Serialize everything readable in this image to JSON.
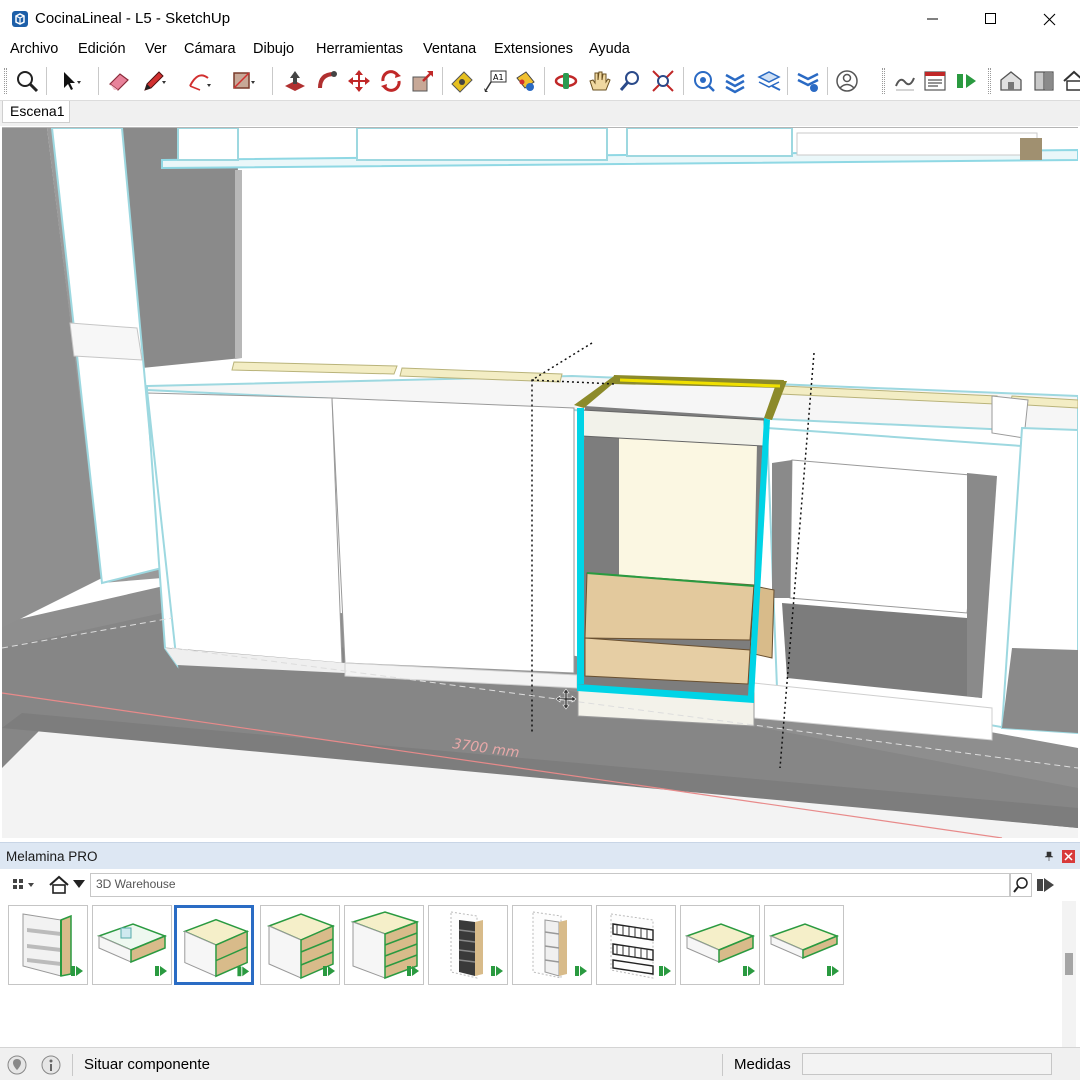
{
  "window": {
    "title": "CocinaLineal - L5 - SketchUp",
    "minimize_icon": "minimize-icon",
    "maximize_icon": "maximize-icon",
    "close_icon": "close-icon"
  },
  "menu": {
    "items": [
      "Archivo",
      "Edición",
      "Ver",
      "Cámara",
      "Dibujo",
      "Herramientas",
      "Ventana",
      "Extensiones",
      "Ayuda"
    ]
  },
  "toolbar": {
    "tools": [
      "zoom-extents",
      "select",
      "eraser",
      "pencil-line",
      "arc",
      "rectangle",
      "push-pull",
      "follow-me",
      "move",
      "rotate",
      "scale",
      "tape-measure",
      "text-label",
      "paint-bucket",
      "orbit",
      "pan",
      "zoom",
      "zoom-window",
      "section-plane",
      "layer-stack",
      "tags",
      "dynamic-components",
      "account",
      "sandbox",
      "report",
      "export",
      "warehouse",
      "extension-manager",
      "home-3d"
    ]
  },
  "scenes": {
    "tabs": [
      "Escena1"
    ]
  },
  "viewport": {
    "dimension_label": "3700 mm",
    "colors": {
      "floor": "#8c8c8c",
      "floor_dark": "#7a7a7a",
      "cabinet_white": "#ffffff",
      "edge_cyan": "#00d4e6",
      "edge_lightblue": "#aee6ee",
      "wood": "#e2c89c",
      "cream": "#fbf7e2",
      "yellow_highlight": "#f0e000",
      "olive": "#8c8a2a"
    }
  },
  "tray": {
    "title": "Melamina PRO",
    "pin_icon": "pin-icon",
    "close_icon": "close-icon",
    "search": {
      "placeholder": "3D Warehouse"
    },
    "thumbnails": [
      {
        "name": "mueble-estantes-frontal"
      },
      {
        "name": "cajon-organizador"
      },
      {
        "name": "cajon-grande",
        "selected": true
      },
      {
        "name": "cajonera-3"
      },
      {
        "name": "cajonera-4"
      },
      {
        "name": "columna-negra"
      },
      {
        "name": "columna-estantes"
      },
      {
        "name": "escurridor-metalico"
      },
      {
        "name": "bandeja-1"
      },
      {
        "name": "bandeja-2"
      }
    ]
  },
  "status": {
    "message": "Situar componente",
    "measure_label": "Medidas",
    "measure_value": ""
  }
}
